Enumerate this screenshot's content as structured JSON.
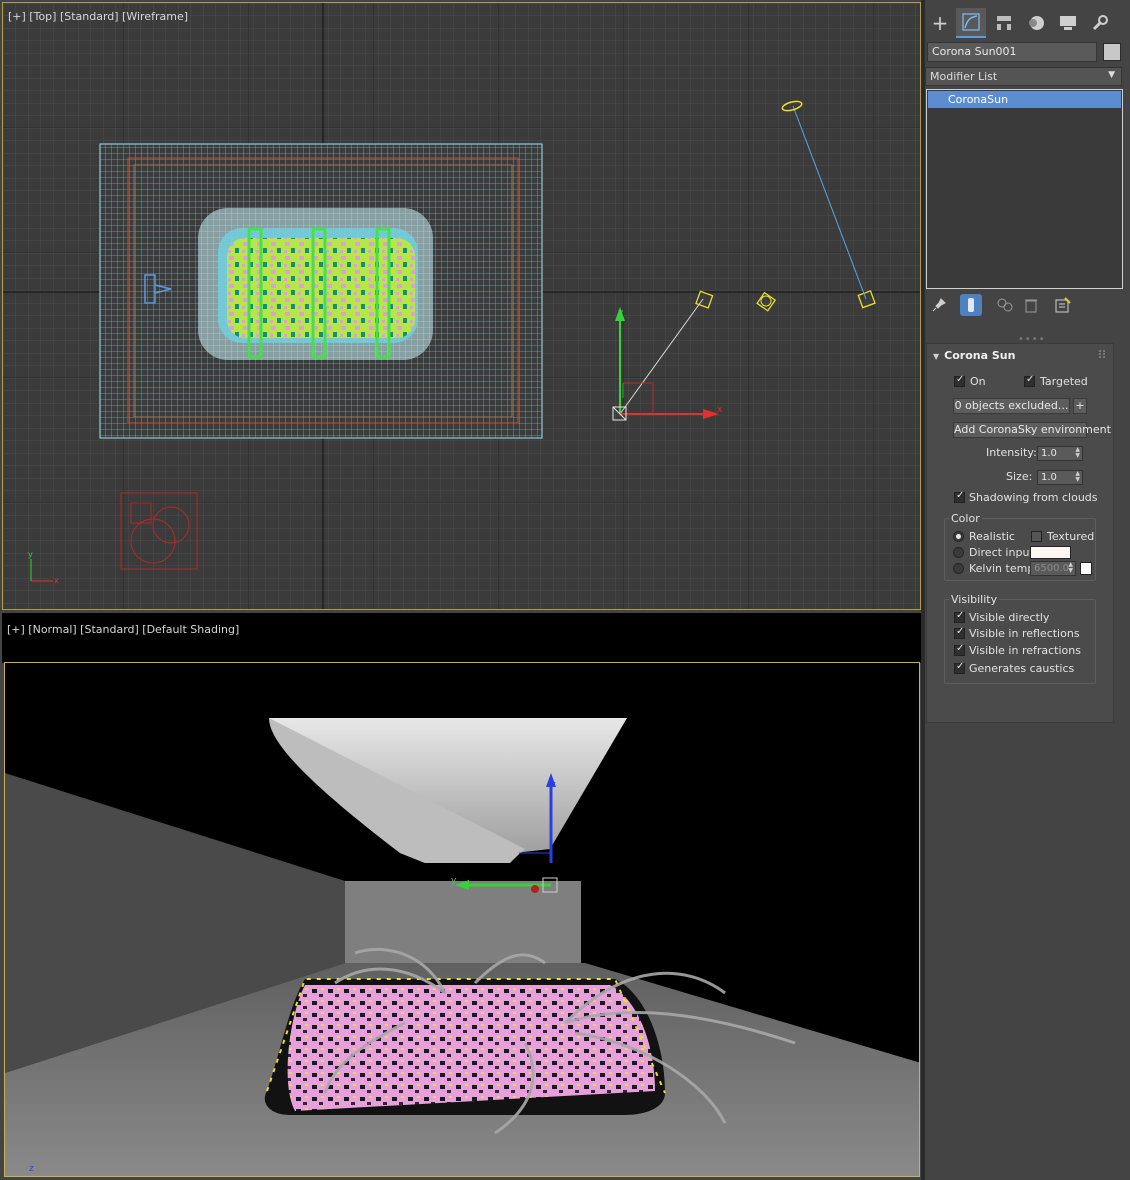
{
  "viewports": {
    "top_label": "[+] [Top] [Standard] [Wireframe]",
    "persp_label": "[+] [Normal] [Standard] [Default Shading]"
  },
  "command_panel": {
    "tabs": [
      {
        "name": "create",
        "icon": "plus-icon"
      },
      {
        "name": "modify",
        "icon": "modify-curve-icon",
        "active": true
      },
      {
        "name": "hierarchy",
        "icon": "hierarchy-icon"
      },
      {
        "name": "motion",
        "icon": "motion-icon"
      },
      {
        "name": "display",
        "icon": "display-icon"
      },
      {
        "name": "utilities",
        "icon": "wrench-icon"
      }
    ],
    "object_name": "Corona Sun001",
    "object_color": "#c8c8c8",
    "modifier_list_label": "Modifier List",
    "stack_items": [
      "CoronaSun"
    ]
  },
  "rollout": {
    "title": "Corona Sun",
    "on_label": "On",
    "targeted_label": "Targeted",
    "excluded_button": "0 objects excluded...",
    "plus_button": "+",
    "add_sky_button": "Add CoronaSky environment",
    "intensity_label": "Intensity:",
    "intensity_value": "1.0",
    "size_label": "Size:",
    "size_value": "1.0",
    "shadowing_label": "Shadowing from clouds",
    "color_group": {
      "title": "Color",
      "realistic": "Realistic",
      "textured": "Textured",
      "direct_input": "Direct input",
      "direct_input_color": "#fdf6f2",
      "kelvin_temp": "Kelvin temp",
      "kelvin_value": "6500.0",
      "kelvin_color": "#ffffff"
    },
    "visibility_group": {
      "title": "Visibility",
      "items": [
        "Visible directly",
        "Visible in reflections",
        "Visible in refractions",
        "Generates caustics"
      ]
    }
  }
}
